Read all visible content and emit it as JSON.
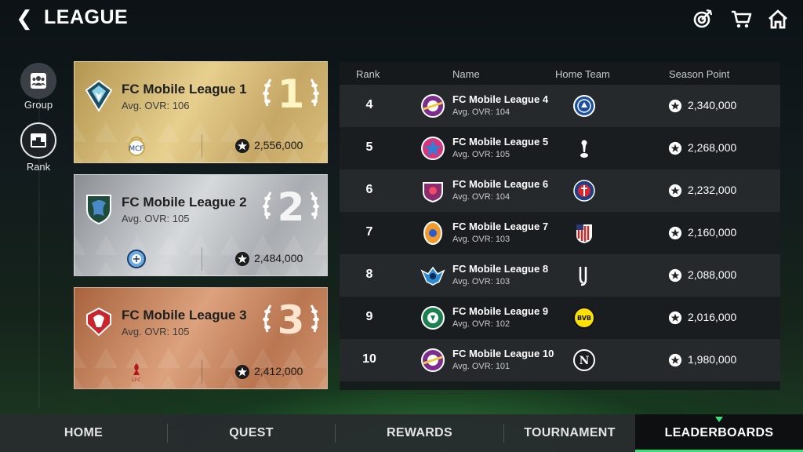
{
  "header": {
    "back_glyph": "❮",
    "title": "LEAGUE",
    "icons": [
      "target-icon",
      "cart-icon",
      "home-icon"
    ]
  },
  "rail": {
    "items": [
      {
        "label": "Group",
        "icon": "group-icon"
      },
      {
        "label": "Rank",
        "icon": "podium-icon"
      }
    ]
  },
  "podium": [
    {
      "rank": "1",
      "name": "FC Mobile League 1",
      "ovr": "Avg. OVR: 106",
      "home_team": "real-madrid-crest",
      "points": "2,556,000",
      "tier": "gold"
    },
    {
      "rank": "2",
      "name": "FC Mobile League 2",
      "ovr": "Avg. OVR: 105",
      "home_team": "manchester-city-crest",
      "points": "2,484,000",
      "tier": "silver"
    },
    {
      "rank": "3",
      "name": "FC Mobile League 3",
      "ovr": "Avg. OVR: 105",
      "home_team": "liverpool-crest",
      "points": "2,412,000",
      "tier": "bronze"
    }
  ],
  "table": {
    "headers": {
      "rank": "Rank",
      "name": "Name",
      "home": "Home Team",
      "points": "Season Point"
    },
    "rows": [
      {
        "rank": "4",
        "name": "FC Mobile League 4",
        "ovr": "Avg. OVR: 104",
        "home_team": "chelsea-crest",
        "points": "2,340,000"
      },
      {
        "rank": "5",
        "name": "FC Mobile League 5",
        "ovr": "Avg. OVR: 105",
        "home_team": "tottenham-crest",
        "points": "2,268,000"
      },
      {
        "rank": "6",
        "name": "FC Mobile League 6",
        "ovr": "Avg. OVR: 104",
        "home_team": "psg-crest",
        "points": "2,232,000"
      },
      {
        "rank": "7",
        "name": "FC Mobile League 7",
        "ovr": "Avg. OVR: 103",
        "home_team": "atletico-madrid-crest",
        "points": "2,160,000"
      },
      {
        "rank": "8",
        "name": "FC Mobile League 8",
        "ovr": "Avg. OVR: 103",
        "home_team": "juventus-crest",
        "points": "2,088,000"
      },
      {
        "rank": "9",
        "name": "FC Mobile League 9",
        "ovr": "Avg. OVR: 102",
        "home_team": "dortmund-crest",
        "points": "2,016,000"
      },
      {
        "rank": "10",
        "name": "FC Mobile League 10",
        "ovr": "Avg. OVR: 101",
        "home_team": "napoli-crest",
        "points": "1,980,000"
      }
    ]
  },
  "nav": {
    "items": [
      {
        "label": "HOME",
        "active": false
      },
      {
        "label": "QUEST",
        "active": false
      },
      {
        "label": "REWARDS",
        "active": false
      },
      {
        "label": "TOURNAMENT",
        "active": false
      },
      {
        "label": "LEADERBOARDS",
        "active": true
      }
    ]
  },
  "colors": {
    "accent": "#33e07a",
    "gold": "#e7cf8e",
    "silver": "#d6d9dc",
    "bronze": "#dca27d"
  }
}
